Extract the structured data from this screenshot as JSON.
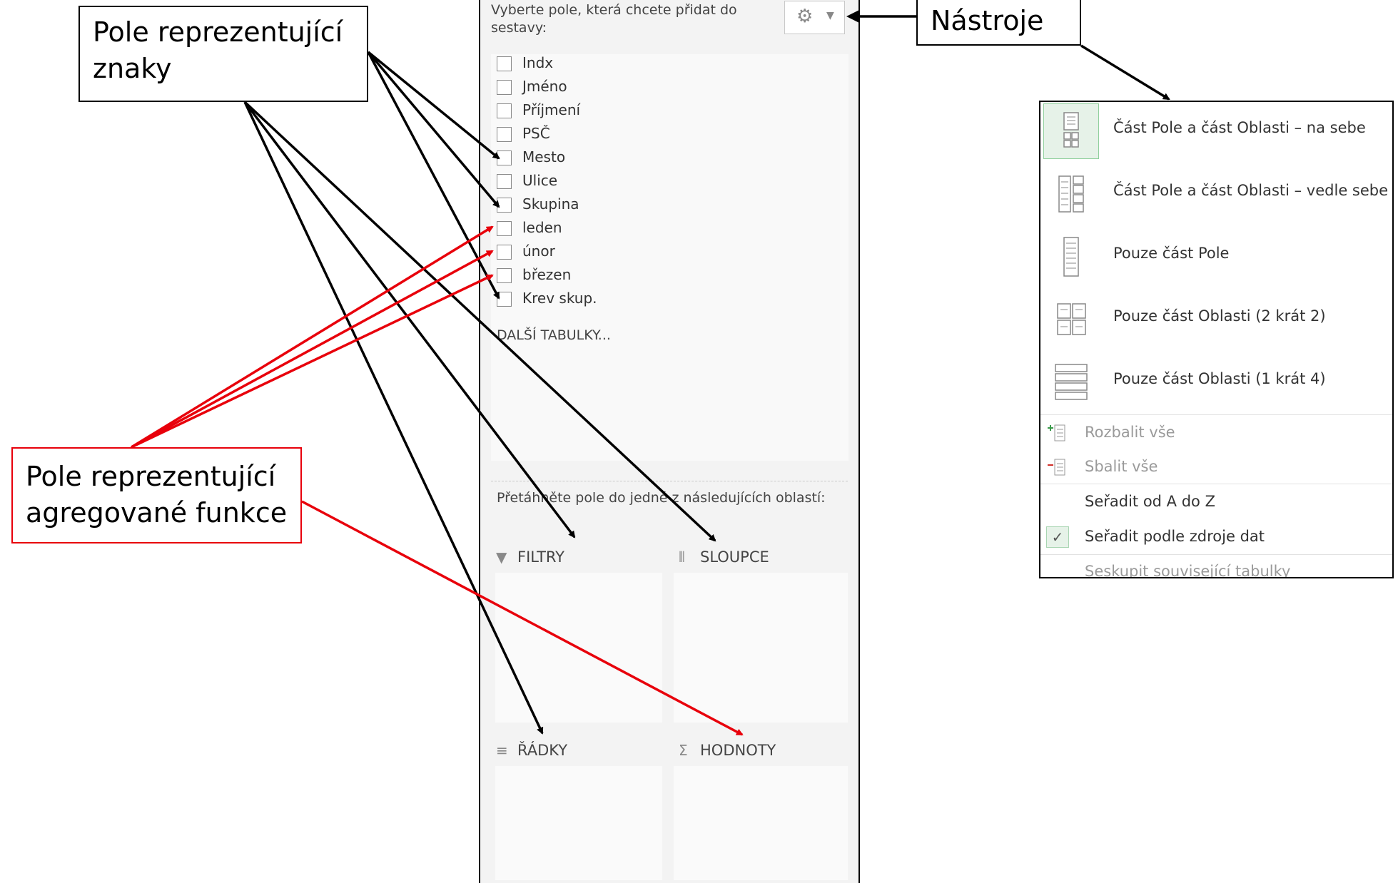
{
  "callouts": {
    "char_fields_line1": "Pole reprezentující",
    "char_fields_line2": "znaky",
    "agg_fields_line1": "Pole reprezentující",
    "agg_fields_line2": "agregované funkce",
    "tools": "Nástroje"
  },
  "pivot_panel": {
    "heading": "Vyberte pole, která chcete přidat do sestavy:",
    "fields": [
      "Indx",
      "Jméno",
      "Příjmení",
      "PSČ",
      "Mesto",
      "Ulice",
      "Skupina",
      "leden",
      "únor",
      "březen",
      "Krev skup."
    ],
    "more_tables": "DALŠÍ TABULKY...",
    "drag_heading": "Přetáhněte pole do jedné z následujících oblastí:",
    "areas": {
      "filters": "FILTRY",
      "columns": "SLOUPCE",
      "rows": "ŘÁDKY",
      "values": "HODNOTY"
    },
    "area_icons": {
      "filters": "funnel-icon",
      "columns": "columns-icon",
      "rows": "rows-icon",
      "values": "sigma-icon"
    },
    "tools_icon": "gear-icon"
  },
  "tools_menu": {
    "layouts": [
      "Část Pole a část Oblasti – na sebe",
      "Část Pole a část Oblasti – vedle sebe",
      "Pouze část Pole",
      "Pouze část Oblasti (2 krát 2)",
      "Pouze část Oblasti (1 krát 4)"
    ],
    "expand_all": "Rozbalit vše",
    "collapse_all": "Sbalit vše",
    "sort_az": "Seřadit od A do Z",
    "sort_source": "Seřadit podle zdroje dat",
    "group_related": "Seskupit související tabulky"
  },
  "colors": {
    "black_arrow": "#000000",
    "red_arrow": "#e8000b",
    "panel_bg": "#f3f3f3",
    "selected_green": "#e6f2e8"
  }
}
